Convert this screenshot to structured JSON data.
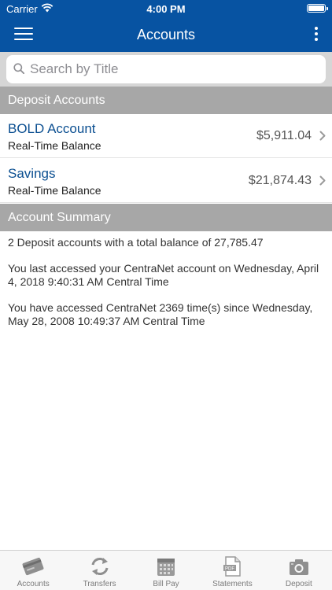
{
  "status_bar": {
    "carrier": "Carrier",
    "time": "4:00 PM"
  },
  "nav": {
    "title": "Accounts"
  },
  "search": {
    "placeholder": "Search by Title",
    "value": ""
  },
  "sections": {
    "deposit_accounts": "Deposit Accounts",
    "account_summary": "Account Summary"
  },
  "accounts": [
    {
      "name": "BOLD Account",
      "subtitle": "Real-Time Balance",
      "balance": "$5,911.04"
    },
    {
      "name": "Savings",
      "subtitle": "Real-Time Balance",
      "balance": "$21,874.43"
    }
  ],
  "summary": {
    "line1": "2 Deposit accounts with a total balance of 27,785.47",
    "line2": "You last accessed your CentraNet account on Wednesday, April 4, 2018 9:40:31 AM Central Time",
    "line3": "You have accessed CentraNet 2369 time(s) since Wednesday, May 28, 2008 10:49:37 AM Central Time"
  },
  "tabs": [
    {
      "label": "Accounts",
      "icon": "card-icon"
    },
    {
      "label": "Transfers",
      "icon": "transfer-icon"
    },
    {
      "label": "Bill Pay",
      "icon": "calendar-icon"
    },
    {
      "label": "Statements",
      "icon": "pdf-icon"
    },
    {
      "label": "Deposit",
      "icon": "camera-icon"
    }
  ],
  "colors": {
    "brand_blue": "#0753a2",
    "link_blue": "#0b4f91",
    "section_gray": "#a7a7a7",
    "search_bg": "#d6d6d6"
  }
}
